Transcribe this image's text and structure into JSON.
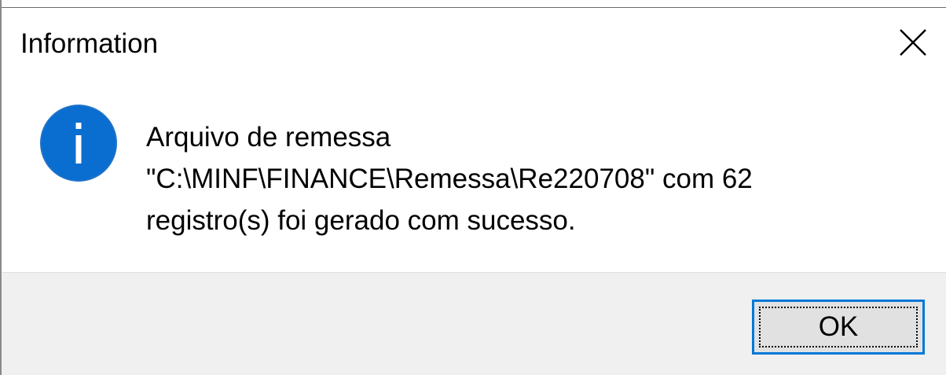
{
  "window": {
    "title": "Information"
  },
  "icons": {
    "close": "close-icon",
    "info": "information-icon"
  },
  "message": {
    "lines": [
      "Arquivo de remessa",
      "\"C:\\MINF\\FINANCE\\Remessa\\Re220708\" com 62",
      "registro(s) foi gerado com sucesso."
    ]
  },
  "buttons": {
    "ok_label": "OK"
  },
  "colors": {
    "accent": "#0078d7",
    "footer_bg": "#f0f0f0",
    "button_bg": "#e1e1e1"
  }
}
